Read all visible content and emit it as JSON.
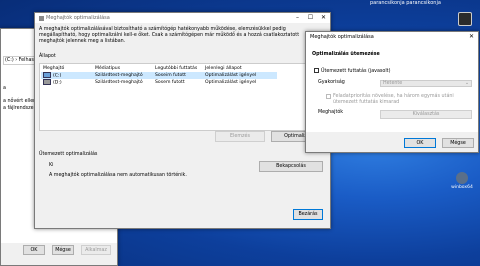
{
  "desktop": {
    "top_text": "parancsikonja  parancsikonja",
    "icons": [
      {
        "label": ""
      },
      {
        "label": "winbox64"
      }
    ]
  },
  "back_window": {
    "path": "(C:) › Felhaszn",
    "fragments": [
      "a",
      "a nővért elleni",
      "a fájlrendszer"
    ],
    "ok_label": "OK",
    "cancel_label": "Mégse",
    "apply_label": "Alkalmaz"
  },
  "main_window": {
    "title": "Meghajtók optimalizálása",
    "description": "A meghajtók optimalizálásával biztosítható a számítógép hatékonyabb működése, elemzésükkel pedig megállapítható, hogy optimalizálni kell-e őket. Csak a számítógépen már működő és a hozzá csatlakoztatott meghajtók jelennek meg a listában.",
    "status_label": "Állapot",
    "columns": [
      "Meghajtó",
      "Médiatípus",
      "Legutóbbi futtatás",
      "Jelenlegi állapot"
    ],
    "rows": [
      [
        "(C:)",
        "Szilárdtest-meghajtó",
        "Soseim futott",
        "Optimalizálást igényel"
      ],
      [
        "(D:)",
        "Szilárdtest-meghajtó",
        "Sosem futott",
        "Optimalizálást igényel"
      ]
    ],
    "analyze_label": "Elemzés",
    "optimize_label": "Optimaliza",
    "scheduled_header": "Ütemezett optimalizálás",
    "scheduled_state": "Ki",
    "scheduled_desc": "A meghajtók optimalizálása nem automatikusan történik.",
    "change_settings_label": "Bekapcsolás",
    "close_label": "Bezárás"
  },
  "dialog": {
    "title": "Meghajtók optimalizálása",
    "header": "Optimalizálás ütemezése",
    "scheduled_run_label": "Ütemezett futtatás (javasolt)",
    "frequency_label": "Gyakoriság",
    "frequency_value": "Hetente",
    "priority_text": "Feladatprioritás növelése, ha három egymás utáni ütemezett futtatás kimarad",
    "drives_label": "Meghajtók",
    "choose_label": "Kiválasztás",
    "ok_label": "OK",
    "cancel_label": "Mégse"
  }
}
